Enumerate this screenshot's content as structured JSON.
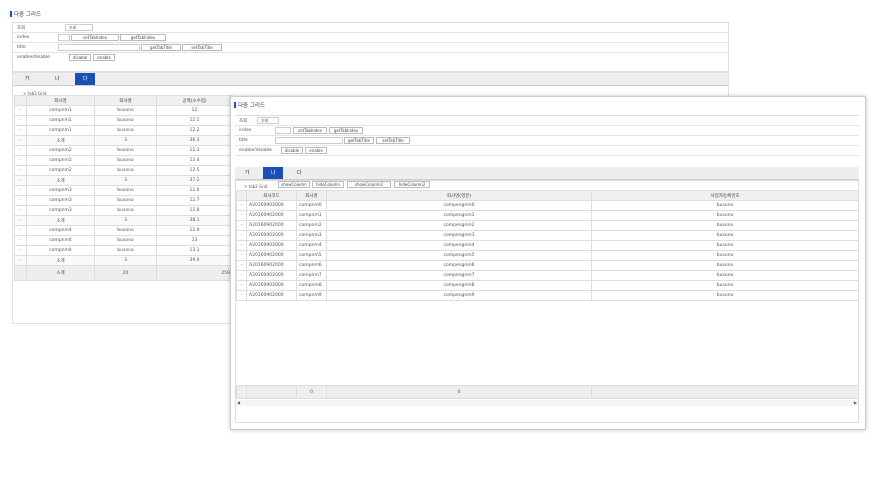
{
  "win1": {
    "title": "다중 그리드",
    "form": {
      "row1_label": "조회",
      "row1_input": "조회",
      "index_label": "index",
      "set_tab_index": "setTabIndex",
      "get_tab_index": "getTabIndex",
      "title_label": "title",
      "get_tab_title": "getTabTitle",
      "set_tab_title": "setTabTitle",
      "enable_label": "enable/disable",
      "disable": "disable",
      "enable": "enable"
    },
    "tabs": [
      "가",
      "나",
      "다"
    ],
    "grid_caption": "> tab3 Grid",
    "columns": [
      "",
      "회사명",
      "회사명",
      "공백(소수점)"
    ],
    "rows": [
      {
        "mark": "-",
        "c1": "compnm1",
        "c2": "busono",
        "c3": "12",
        "sub": false
      },
      {
        "mark": "-",
        "c1": "compnm1",
        "c2": "busono",
        "c3": "12.1",
        "sub": false
      },
      {
        "mark": "-",
        "c1": "compnm1",
        "c2": "busono",
        "c3": "12.2",
        "sub": false
      },
      {
        "mark": "-",
        "c1": "소계",
        "c2": "3",
        "c3": "36.3",
        "sub": true
      },
      {
        "mark": "-",
        "c1": "compnm2",
        "c2": "busono",
        "c3": "12.3",
        "sub": false
      },
      {
        "mark": "-",
        "c1": "compnm2",
        "c2": "busono",
        "c3": "12.4",
        "sub": false
      },
      {
        "mark": "-",
        "c1": "compnm2",
        "c2": "busono",
        "c3": "12.5",
        "sub": false
      },
      {
        "mark": "-",
        "c1": "소계",
        "c2": "3",
        "c3": "37.2",
        "sub": true
      },
      {
        "mark": "-",
        "c1": "compnm3",
        "c2": "busono",
        "c3": "12.6",
        "sub": false
      },
      {
        "mark": "-",
        "c1": "compnm3",
        "c2": "busono",
        "c3": "12.7",
        "sub": false
      },
      {
        "mark": "-",
        "c1": "compnm3",
        "c2": "busono",
        "c3": "12.8",
        "sub": false
      },
      {
        "mark": "-",
        "c1": "소계",
        "c2": "3",
        "c3": "38.1",
        "sub": true
      },
      {
        "mark": "-",
        "c1": "compnm4",
        "c2": "busono",
        "c3": "12.9",
        "sub": false
      },
      {
        "mark": "-",
        "c1": "compnm4",
        "c2": "busono",
        "c3": "13",
        "sub": false
      },
      {
        "mark": "-",
        "c1": "compnm4",
        "c2": "busono",
        "c3": "13.1",
        "sub": false
      },
      {
        "mark": "-",
        "c1": "소계",
        "c2": "3",
        "c3": "39.0",
        "sub": true
      }
    ],
    "footer": {
      "c1": "소계",
      "c2": "20",
      "c3": "259"
    }
  },
  "win2": {
    "title": "다중 그리드",
    "form": {
      "row1_label": "조회",
      "row1_input": "조회",
      "index_label": "index",
      "set_tab_index": "setTabIndex",
      "get_tab_index": "getTabIndex",
      "title_label": "title",
      "get_tab_title": "getTabTitle",
      "set_tab_title": "setTabTitle",
      "enable_label": "enable/disable",
      "disable": "disable",
      "enable": "enable"
    },
    "tabs": [
      "가",
      "나",
      "다"
    ],
    "grid_caption": "> tab2 Grid",
    "grid_buttons": [
      "showColumn",
      "hideColumn",
      "showColumn2",
      "hideColumn2"
    ],
    "columns": [
      "",
      "회사코드",
      "회사명",
      "회사명(영문)",
      "사업자등록번호"
    ],
    "rows": [
      {
        "mark": "-",
        "c1": "A20160902000",
        "c2": "compnm0",
        "c3": "compengnm0",
        "c4": "busono"
      },
      {
        "mark": "-",
        "c1": "A20160902000",
        "c2": "compnm1",
        "c3": "compengnm1",
        "c4": "busono"
      },
      {
        "mark": "-",
        "c1": "A20160902000",
        "c2": "compnm2",
        "c3": "compengnm2",
        "c4": "busono"
      },
      {
        "mark": "-",
        "c1": "A20160902000",
        "c2": "compnm3",
        "c3": "compengnm3",
        "c4": "busono"
      },
      {
        "mark": "-",
        "c1": "A20160902000",
        "c2": "compnm4",
        "c3": "compengnm4",
        "c4": "busono"
      },
      {
        "mark": "-",
        "c1": "A20160902000",
        "c2": "compnm5",
        "c3": "compengnm5",
        "c4": "busono"
      },
      {
        "mark": "-",
        "c1": "A20160902000",
        "c2": "compnm6",
        "c3": "compengnm6",
        "c4": "busono"
      },
      {
        "mark": "-",
        "c1": "A20160902000",
        "c2": "compnm7",
        "c3": "compengnm7",
        "c4": "busono"
      },
      {
        "mark": "-",
        "c1": "A20160902000",
        "c2": "compnm8",
        "c3": "compengnm8",
        "c4": "busono"
      },
      {
        "mark": "-",
        "c1": "A20160902000",
        "c2": "compnm9",
        "c3": "compengnm9",
        "c4": "busono"
      }
    ],
    "footer": {
      "c2": "0",
      "c3": "0"
    },
    "scroll_left": "◀",
    "scroll_right": "▶"
  }
}
